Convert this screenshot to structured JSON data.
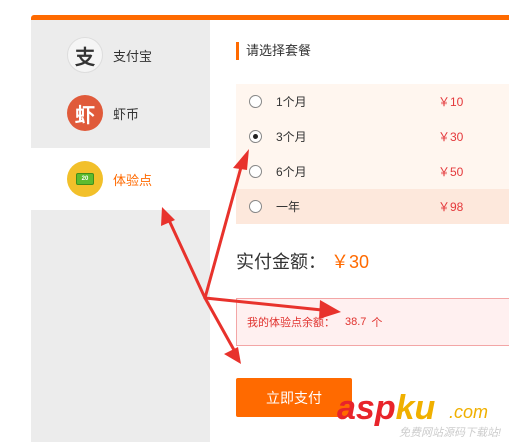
{
  "sidebar": {
    "items": [
      {
        "label": "支付宝",
        "icon": "alipay-icon",
        "glyph": "支",
        "selected": false
      },
      {
        "label": "虾币",
        "icon": "xiabi-icon",
        "glyph": "虾",
        "selected": false
      },
      {
        "label": "体验点",
        "icon": "points-icon",
        "glyph": "20",
        "selected": true
      }
    ]
  },
  "main": {
    "section_title": "请选择套餐",
    "options": [
      {
        "name": "1个月",
        "price": "￥10",
        "selected": false
      },
      {
        "name": "3个月",
        "price": "￥30",
        "selected": true
      },
      {
        "name": "6个月",
        "price": "￥50",
        "selected": false
      },
      {
        "name": "一年",
        "price": "￥98",
        "selected": false
      }
    ],
    "total_label": "实付金额：",
    "total_amount": "￥30",
    "balance_label": "我的体验点余额：",
    "balance_value": "38.7",
    "balance_unit": "个",
    "pay_button": "立即支付"
  },
  "watermark": {
    "brand_asp": "asp",
    "brand_ku": "ku",
    "brand_com": ".com",
    "tagline": "免费网站源码下载站!"
  },
  "colors": {
    "accent": "#ff6a00",
    "price": "#e4393c",
    "annotation_arrow": "#e8322c"
  }
}
